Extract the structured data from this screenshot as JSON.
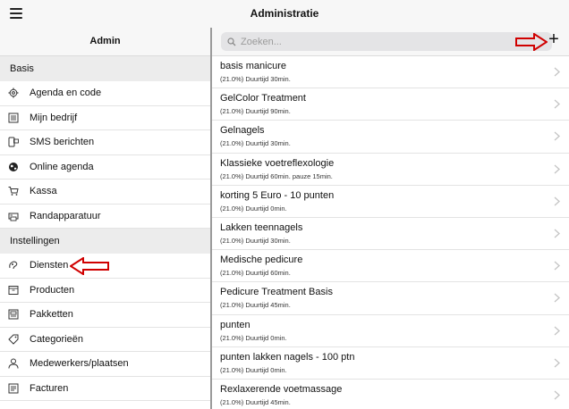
{
  "header": {
    "title": "Administratie",
    "menu_icon": "hamburger-menu-icon"
  },
  "sidebar": {
    "title": "Admin",
    "sections": [
      {
        "label": "Basis",
        "items": [
          {
            "label": "Agenda en code",
            "icon": "gear-icon"
          },
          {
            "label": "Mijn bedrijf",
            "icon": "building-list-icon"
          },
          {
            "label": "SMS berichten",
            "icon": "phone-message-icon"
          },
          {
            "label": "Online agenda",
            "icon": "globe-icon"
          },
          {
            "label": "Kassa",
            "icon": "cart-icon"
          },
          {
            "label": "Randapparatuur",
            "icon": "printer-icon"
          }
        ]
      },
      {
        "label": "Instellingen",
        "items": [
          {
            "label": "Diensten",
            "icon": "services-icon"
          },
          {
            "label": "Producten",
            "icon": "box-icon"
          },
          {
            "label": "Pakketten",
            "icon": "package-icon"
          },
          {
            "label": "Categorieën",
            "icon": "tag-icon"
          },
          {
            "label": "Medewerkers/plaatsen",
            "icon": "person-icon"
          },
          {
            "label": "Facturen",
            "icon": "invoice-icon"
          }
        ]
      }
    ]
  },
  "search": {
    "placeholder": "Zoeken...",
    "value": "",
    "icon": "search-icon"
  },
  "add_button": {
    "label": "+",
    "icon": "plus-icon"
  },
  "accent_color": "#d00000",
  "services": [
    {
      "name": "basis manicure",
      "detail": "(21.0%) Duurtijd 30min."
    },
    {
      "name": "GelColor Treatment",
      "detail": "(21.0%) Duurtijd 90min."
    },
    {
      "name": "Gelnagels",
      "detail": "(21.0%) Duurtijd 30min."
    },
    {
      "name": "Klassieke voetreflexologie",
      "detail": "(21.0%) Duurtijd 60min. pauze 15min."
    },
    {
      "name": "korting 5 Euro - 10 punten",
      "detail": "(21.0%) Duurtijd 0min."
    },
    {
      "name": "Lakken teennagels",
      "detail": "(21.0%) Duurtijd 30min."
    },
    {
      "name": "Medische pedicure",
      "detail": "(21.0%) Duurtijd 60min."
    },
    {
      "name": "Pedicure Treatment Basis",
      "detail": "(21.0%) Duurtijd 45min."
    },
    {
      "name": "punten",
      "detail": "(21.0%) Duurtijd 0min."
    },
    {
      "name": "punten lakken nagels - 100 ptn",
      "detail": "(21.0%) Duurtijd 0min."
    },
    {
      "name": "Rexlaxerende voetmassage",
      "detail": "(21.0%) Duurtijd 45min."
    }
  ]
}
